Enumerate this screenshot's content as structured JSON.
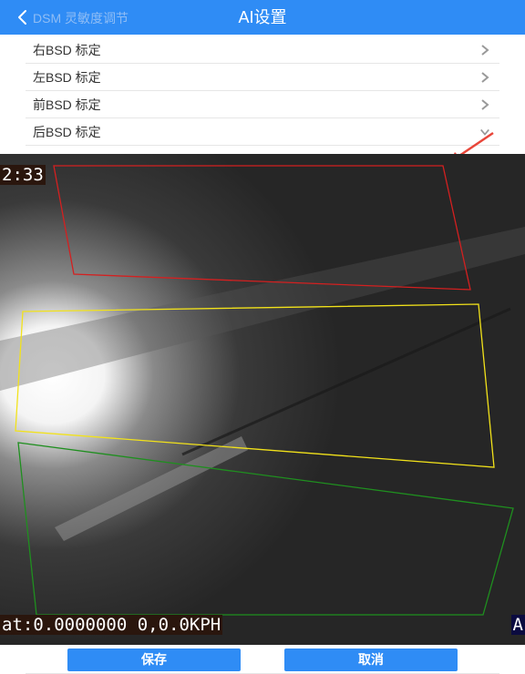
{
  "header": {
    "title": "AI设置",
    "faded_item": "DSM 灵敏度调节"
  },
  "list": {
    "items": [
      {
        "label": "右BSD 标定"
      },
      {
        "label": "左BSD 标定"
      },
      {
        "label": "前BSD 标定"
      },
      {
        "label": "后BSD 标定"
      }
    ]
  },
  "video": {
    "time_overlay": "2:33",
    "gps_overlay": "at:0.0000000 0,0.0KPH",
    "right_overlay": "A",
    "zones": [
      {
        "name": "red-zone",
        "color": "#d42020"
      },
      {
        "name": "yellow-zone",
        "color": "#f2e21a"
      },
      {
        "name": "green-zone",
        "color": "#1f8f1f"
      }
    ]
  },
  "footer": {
    "save_label": "保存",
    "cancel_label": "取消"
  },
  "colors": {
    "accent": "#2f8cf5",
    "annotation_arrow": "#e8463a"
  }
}
